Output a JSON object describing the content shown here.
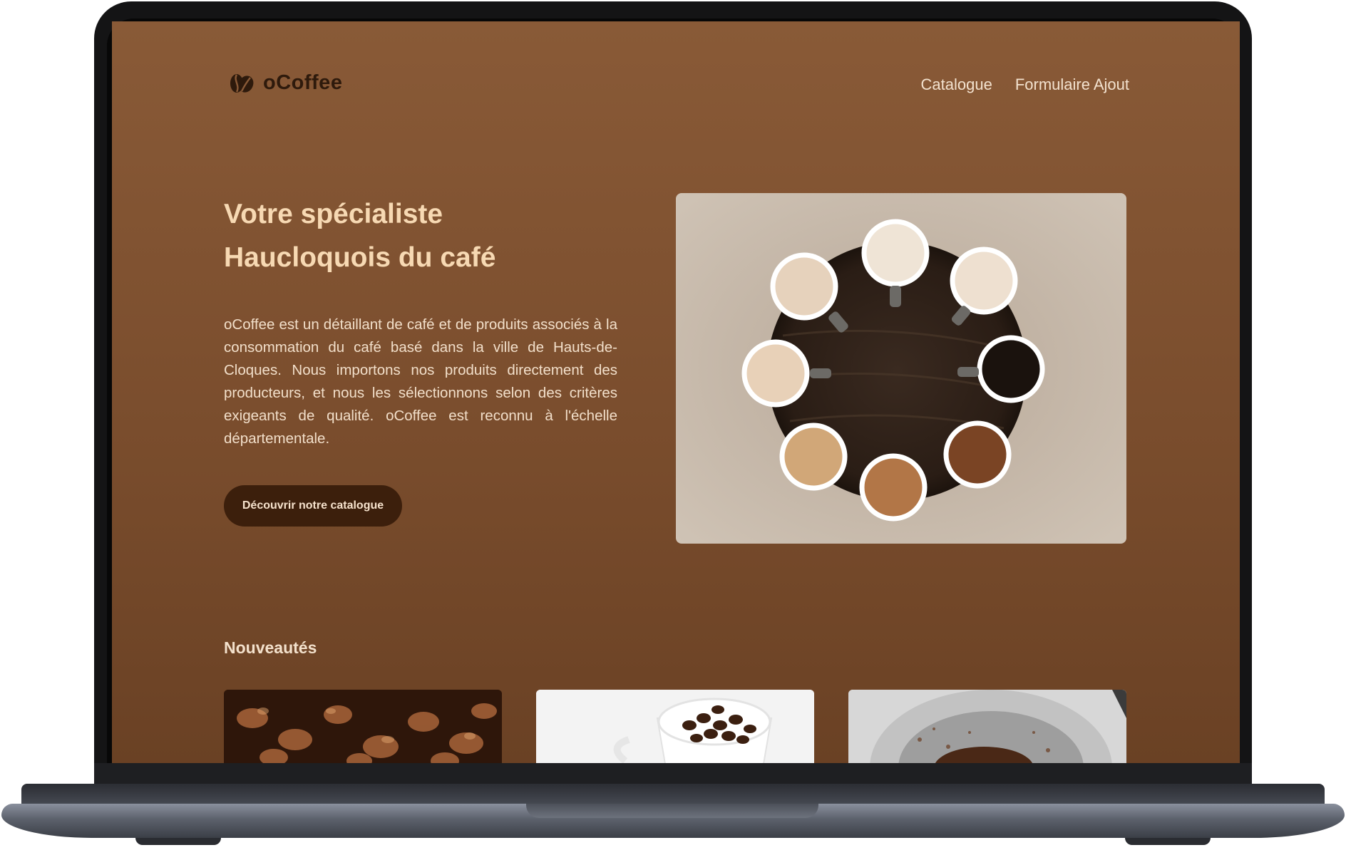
{
  "site": {
    "brand": "oCoffee",
    "nav": [
      "Catalogue",
      "Formulaire Ajout"
    ]
  },
  "hero": {
    "title_line1": "Votre spécialiste",
    "title_line2": "Haucloquois du café",
    "text": "oCoffee est un détaillant de café et de produits associés à la consommation du café basé dans la ville de Hauts-de-Cloques. Nous importons nos produits directement des producteurs, et nous les sélectionnons selon des critères exigeants de qualité. oCoffee est reconnu à l'échelle départementale.",
    "cta": "Découvrir notre catalogue",
    "image_icon": "coffee-cups-photo"
  },
  "news": {
    "title": "Nouveautés",
    "cards": [
      "coffee-beans-photo",
      "coffee-cup-beans-photo",
      "ground-coffee-photo"
    ]
  },
  "colors": {
    "background": "#895a37",
    "accent": "#f7d9b3",
    "button": "#3c1f0c"
  }
}
